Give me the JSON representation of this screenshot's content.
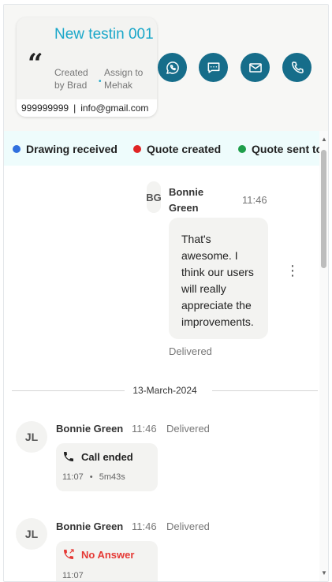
{
  "lead": {
    "title": "New testin 001",
    "created_by": "Created by Brad",
    "assign_to": "Assign to Mehak",
    "phone": "999999999",
    "separator": "|",
    "email": "info@gmail.com",
    "quote_glyph": "“"
  },
  "actions": [
    {
      "name": "whatsapp-button",
      "icon": "whatsapp-icon"
    },
    {
      "name": "message-button",
      "icon": "chat-icon"
    },
    {
      "name": "email-button",
      "icon": "mail-icon"
    },
    {
      "name": "call-button",
      "icon": "phone-icon"
    }
  ],
  "legend": [
    {
      "label": "Drawing received",
      "color": "#2f6fde"
    },
    {
      "label": "Quote created",
      "color": "#e02424"
    },
    {
      "label": "Quote sent to",
      "color": "#1e9e4a"
    }
  ],
  "messages": {
    "first": {
      "initials": "BG",
      "sender": "Bonnie Green",
      "time": "11:46",
      "text": "That's awesome. I think our users will really appreciate the improvements.",
      "status": "Delivered"
    },
    "date_separator": "13-March-2024",
    "call1": {
      "initials": "JL",
      "sender": "Bonnie Green",
      "time": "11:46",
      "status": "Delivered",
      "title": "Call ended",
      "call_time": "11:07",
      "bullet": "•",
      "duration": "5m43s"
    },
    "call2": {
      "initials": "JL",
      "sender": "Bonnie Green",
      "time": "11:46",
      "status": "Delivered",
      "title": "No Answer",
      "call_time": "11:07"
    }
  },
  "colors": {
    "accent": "#1aa7c9",
    "action_button": "#166d8a",
    "legend_bg": "#eefcfc",
    "missed": "#e53935"
  }
}
